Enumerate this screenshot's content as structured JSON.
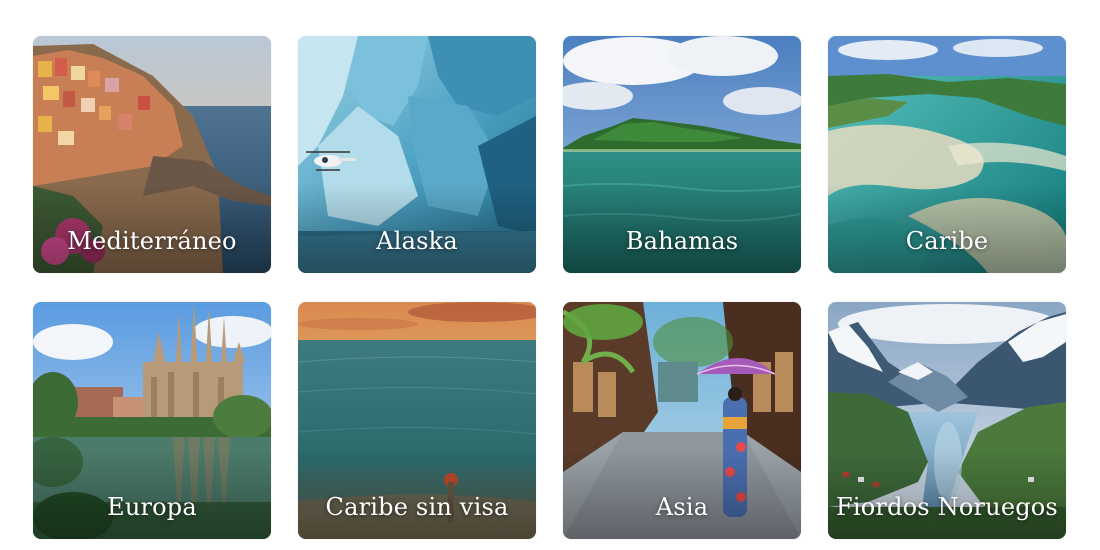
{
  "destinations": [
    {
      "label": "Mediterráneo",
      "scene": "coastal-village"
    },
    {
      "label": "Alaska",
      "scene": "glacier-helicopter"
    },
    {
      "label": "Bahamas",
      "scene": "tropical-island"
    },
    {
      "label": "Caribe",
      "scene": "turquoise-sandbars"
    },
    {
      "label": "Europa",
      "scene": "cathedral-reflection"
    },
    {
      "label": "Caribe sin visa",
      "scene": "sunset-sea"
    },
    {
      "label": "Asia",
      "scene": "street-parasol"
    },
    {
      "label": "Fiordos Noruegos",
      "scene": "mountain-fjord"
    }
  ]
}
